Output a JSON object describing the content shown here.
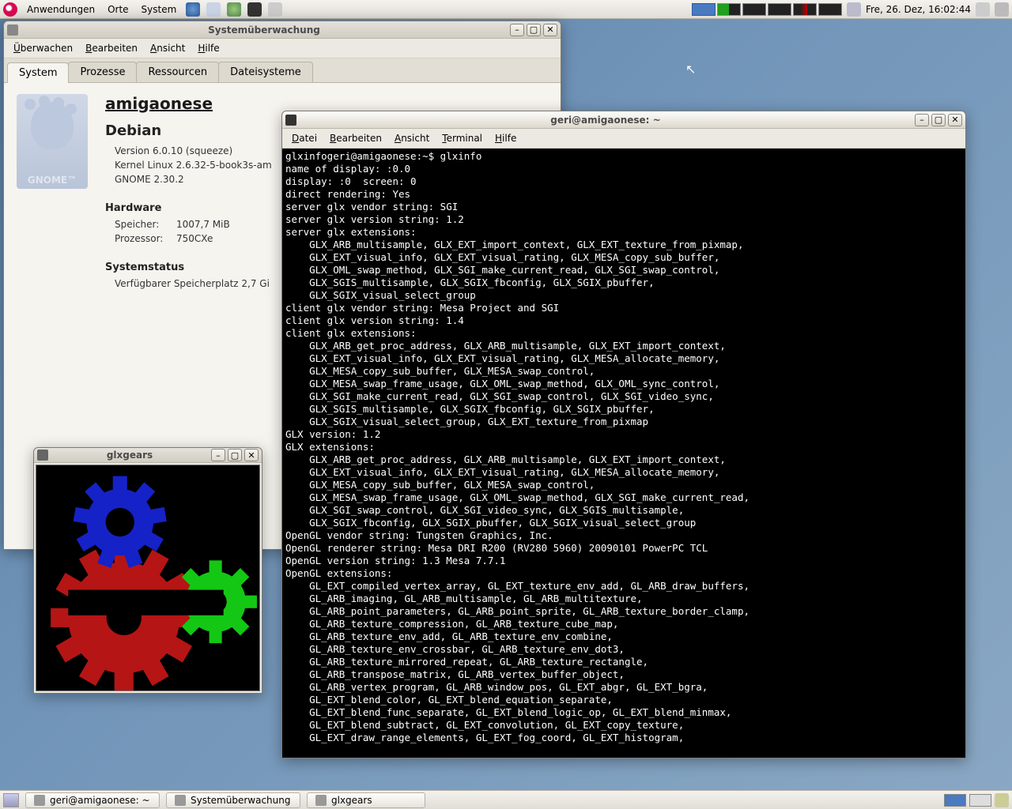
{
  "top_panel": {
    "apps": "Anwendungen",
    "places": "Orte",
    "system": "System",
    "clock": "Fre, 26. Dez, 16:02:44"
  },
  "taskbar": {
    "btn1": "geri@amigaonese: ~",
    "btn2": "Systemüberwachung",
    "btn3": "glxgears"
  },
  "sysmon": {
    "title": "Systemüberwachung",
    "menu": {
      "m1": "Überwachen",
      "m2": "Bearbeiten",
      "m3": "Ansicht",
      "m4": "Hilfe"
    },
    "tabs": {
      "t1": "System",
      "t2": "Prozesse",
      "t3": "Ressourcen",
      "t4": "Dateisysteme"
    },
    "gnome_label": "GNOME™",
    "hostname": "amigaonese",
    "distro": "Debian",
    "version": "Version 6.0.10 (squeeze)",
    "kernel": "Kernel Linux 2.6.32-5-book3s-am",
    "gnome": "GNOME 2.30.2",
    "hw_title": "Hardware",
    "mem_label": "Speicher:",
    "mem_value": "1007,7 MiB",
    "cpu_label": "Prozessor:",
    "cpu_value": "750CXe",
    "status_title": "Systemstatus",
    "disk": "Verfügbarer Speicherplatz 2,7 Gi"
  },
  "glxgears": {
    "title": "glxgears"
  },
  "terminal": {
    "title": "geri@amigaonese: ~",
    "menu": {
      "m1": "Datei",
      "m2": "Bearbeiten",
      "m3": "Ansicht",
      "m4": "Terminal",
      "m5": "Hilfe"
    },
    "lines": [
      "glxinfogeri@amigaonese:~$ glxinfo",
      "name of display: :0.0",
      "display: :0  screen: 0",
      "direct rendering: Yes",
      "server glx vendor string: SGI",
      "server glx version string: 1.2",
      "server glx extensions:",
      "    GLX_ARB_multisample, GLX_EXT_import_context, GLX_EXT_texture_from_pixmap,",
      "    GLX_EXT_visual_info, GLX_EXT_visual_rating, GLX_MESA_copy_sub_buffer,",
      "    GLX_OML_swap_method, GLX_SGI_make_current_read, GLX_SGI_swap_control,",
      "    GLX_SGIS_multisample, GLX_SGIX_fbconfig, GLX_SGIX_pbuffer,",
      "    GLX_SGIX_visual_select_group",
      "client glx vendor string: Mesa Project and SGI",
      "client glx version string: 1.4",
      "client glx extensions:",
      "    GLX_ARB_get_proc_address, GLX_ARB_multisample, GLX_EXT_import_context,",
      "    GLX_EXT_visual_info, GLX_EXT_visual_rating, GLX_MESA_allocate_memory,",
      "    GLX_MESA_copy_sub_buffer, GLX_MESA_swap_control,",
      "    GLX_MESA_swap_frame_usage, GLX_OML_swap_method, GLX_OML_sync_control,",
      "    GLX_SGI_make_current_read, GLX_SGI_swap_control, GLX_SGI_video_sync,",
      "    GLX_SGIS_multisample, GLX_SGIX_fbconfig, GLX_SGIX_pbuffer,",
      "    GLX_SGIX_visual_select_group, GLX_EXT_texture_from_pixmap",
      "GLX version: 1.2",
      "GLX extensions:",
      "    GLX_ARB_get_proc_address, GLX_ARB_multisample, GLX_EXT_import_context,",
      "    GLX_EXT_visual_info, GLX_EXT_visual_rating, GLX_MESA_allocate_memory,",
      "    GLX_MESA_copy_sub_buffer, GLX_MESA_swap_control,",
      "    GLX_MESA_swap_frame_usage, GLX_OML_swap_method, GLX_SGI_make_current_read,",
      "    GLX_SGI_swap_control, GLX_SGI_video_sync, GLX_SGIS_multisample,",
      "    GLX_SGIX_fbconfig, GLX_SGIX_pbuffer, GLX_SGIX_visual_select_group",
      "OpenGL vendor string: Tungsten Graphics, Inc.",
      "OpenGL renderer string: Mesa DRI R200 (RV280 5960) 20090101 PowerPC TCL",
      "OpenGL version string: 1.3 Mesa 7.7.1",
      "OpenGL extensions:",
      "    GL_EXT_compiled_vertex_array, GL_EXT_texture_env_add, GL_ARB_draw_buffers,",
      "    GL_ARB_imaging, GL_ARB_multisample, GL_ARB_multitexture,",
      "    GL_ARB_point_parameters, GL_ARB_point_sprite, GL_ARB_texture_border_clamp,",
      "    GL_ARB_texture_compression, GL_ARB_texture_cube_map,",
      "    GL_ARB_texture_env_add, GL_ARB_texture_env_combine,",
      "    GL_ARB_texture_env_crossbar, GL_ARB_texture_env_dot3,",
      "    GL_ARB_texture_mirrored_repeat, GL_ARB_texture_rectangle,",
      "    GL_ARB_transpose_matrix, GL_ARB_vertex_buffer_object,",
      "    GL_ARB_vertex_program, GL_ARB_window_pos, GL_EXT_abgr, GL_EXT_bgra,",
      "    GL_EXT_blend_color, GL_EXT_blend_equation_separate,",
      "    GL_EXT_blend_func_separate, GL_EXT_blend_logic_op, GL_EXT_blend_minmax,",
      "    GL_EXT_blend_subtract, GL_EXT_convolution, GL_EXT_copy_texture,",
      "    GL_EXT_draw_range_elements, GL_EXT_fog_coord, GL_EXT_histogram,"
    ]
  }
}
